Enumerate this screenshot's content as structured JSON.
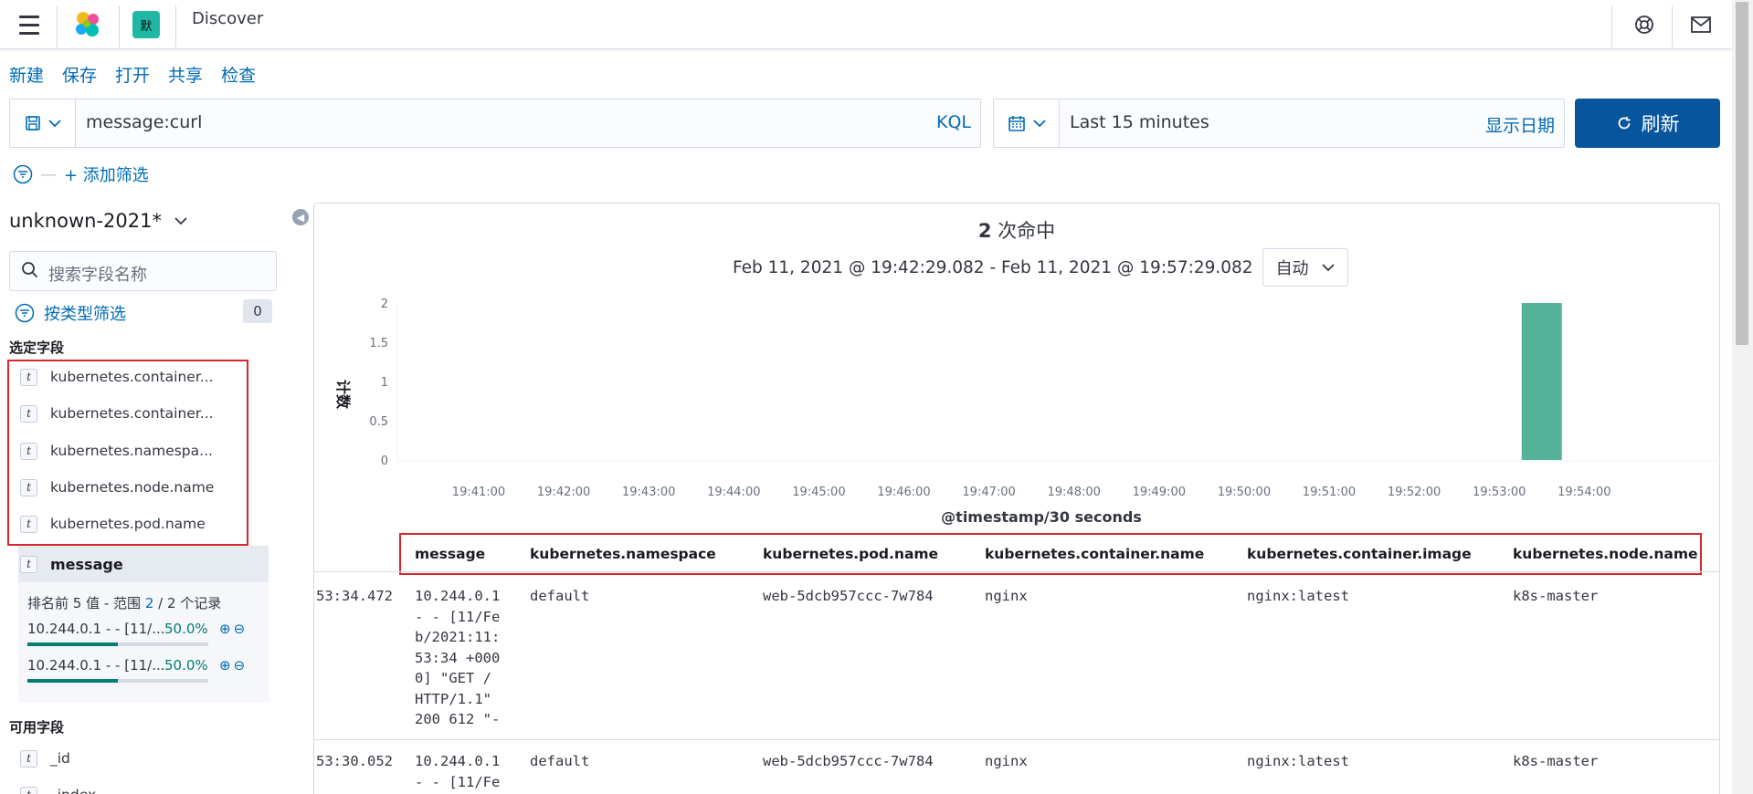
{
  "header": {
    "space_badge": "默",
    "app_title": "Discover"
  },
  "menu": [
    "新建",
    "保存",
    "打开",
    "共享",
    "检查"
  ],
  "query": {
    "text": "message:curl",
    "language": "KQL"
  },
  "time": {
    "range": "Last 15 minutes",
    "show_dates": "显示日期",
    "refresh": "刷新"
  },
  "filters": {
    "add": "+ 添加筛选"
  },
  "sidebar": {
    "index_pattern": "unknown-2021*",
    "search_placeholder": "搜索字段名称",
    "filter_by_type": "按类型筛选",
    "filter_count": "0",
    "selected_title": "选定字段",
    "selected_fields": [
      "kubernetes.container...",
      "kubernetes.container...",
      "kubernetes.namespa...",
      "kubernetes.node.name",
      "kubernetes.pod.name"
    ],
    "active_field": "message",
    "top_values": {
      "prefix": "排名前 5 值 - 范围 ",
      "count": "2",
      "suffix": " / 2 个记录"
    },
    "values": [
      {
        "label": "10.244.0.1 - - [11/...",
        "pct": "50.0%",
        "fraction": 0.5
      },
      {
        "label": "10.244.0.1 - - [11/...",
        "pct": "50.0%",
        "fraction": 0.5
      }
    ],
    "available_title": "可用字段",
    "available_fields": [
      "_id",
      "_index"
    ],
    "field_type_token": "t"
  },
  "main": {
    "hits_count": "2",
    "hits_label": " 次命中",
    "time_range": "Feb 11, 2021 @ 19:42:29.082 - Feb 11, 2021 @ 19:57:29.082",
    "interval": "自动"
  },
  "chart_data": {
    "type": "bar",
    "ylabel": "计数",
    "xlabel": "@timestamp/30 seconds",
    "y_ticks": [
      "0",
      "0.5",
      "1",
      "1.5",
      "2"
    ],
    "x_ticks": [
      "19:41:00",
      "19:42:00",
      "19:43:00",
      "19:44:00",
      "19:45:00",
      "19:46:00",
      "19:47:00",
      "19:48:00",
      "19:49:00",
      "19:50:00",
      "19:51:00",
      "19:52:00",
      "19:53:00",
      "19:54:00"
    ],
    "ylim": [
      0,
      2
    ],
    "bars": [
      {
        "x": "19:53:30",
        "value": 2
      }
    ],
    "color": "#54b399"
  },
  "table": {
    "columns": [
      "message",
      "kubernetes.namespace",
      "kubernetes.pod.name",
      "kubernetes.container.name",
      "kubernetes.container.image",
      "kubernetes.node.name"
    ],
    "rows": [
      {
        "time": "53:34.472",
        "message": "10.244.0.1\n- - [11/Fe\nb/2021:11:\n53:34 +000\n0] \"GET /\nHTTP/1.1\"\n200 612 \"-",
        "namespace": "default",
        "pod": "web-5dcb957ccc-7w784",
        "container": "nginx",
        "image": "nginx:latest",
        "node": "k8s-master"
      },
      {
        "time": "53:30.052",
        "message": "10.244.0.1\n- - [11/Fe",
        "namespace": "default",
        "pod": "web-5dcb957ccc-7w784",
        "container": "nginx",
        "image": "nginx:latest",
        "node": "k8s-master"
      }
    ]
  }
}
